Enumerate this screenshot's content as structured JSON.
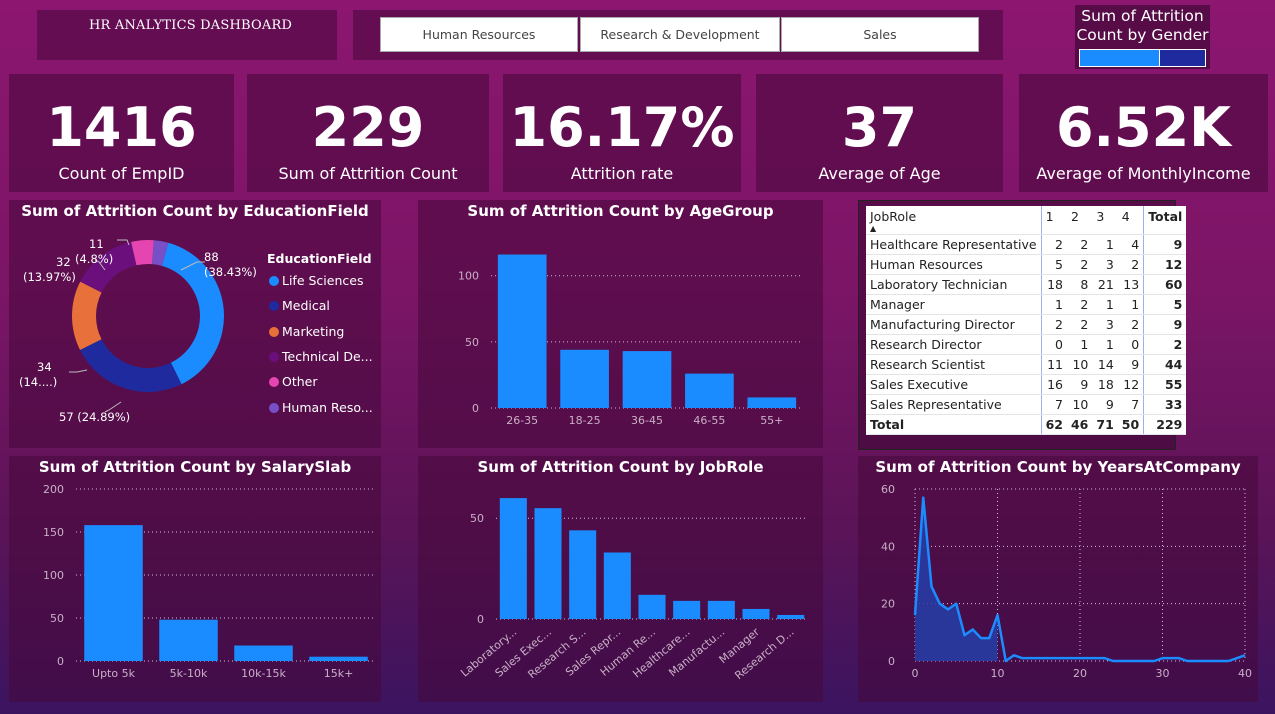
{
  "header": {
    "title": "HR ANALYTICS DASHBOARD"
  },
  "slicer": {
    "departments": [
      "Human Resources",
      "Research & Development",
      "Sales"
    ]
  },
  "gender_card": {
    "title": "Sum of Attrition Count by Gender",
    "colors": [
      "#1b8cff",
      "#1f2a9e"
    ],
    "female_share": 0.63
  },
  "kpis": [
    {
      "value": "1416",
      "label": "Count of EmpID"
    },
    {
      "value": "229",
      "label": "Sum of Attrition Count"
    },
    {
      "value": "16.17%",
      "label": "Attrition rate"
    },
    {
      "value": "37",
      "label": "Average of Age"
    },
    {
      "value": "6.52K",
      "label": "Average of MonthlyIncome"
    }
  ],
  "education": {
    "title": "Sum of Attrition Count by EducationField",
    "legend_title": "EducationField",
    "legend": [
      "Life Sciences",
      "Medical",
      "Marketing",
      "Technical De...",
      "Other",
      "Human Reso..."
    ],
    "labels": {
      "life_sciences": [
        "88",
        "(38.43%)"
      ],
      "medical": [
        "57 (24.89%)"
      ],
      "marketing": [
        "34",
        "(14....)"
      ],
      "technical": [
        "32",
        "(13.97%)"
      ],
      "other": [
        "11",
        "(4.8%)"
      ]
    }
  },
  "age": {
    "title": "Sum of Attrition Count by AgeGroup"
  },
  "salary": {
    "title": "Sum of Attrition Count by SalarySlab"
  },
  "jobrole": {
    "title": "Sum of Attrition Count by JobRole"
  },
  "years": {
    "title": "Sum of Attrition Count by YearsAtCompany"
  },
  "table": {
    "headers": [
      "JobRole",
      "1",
      "2",
      "3",
      "4",
      "Total"
    ],
    "rows": [
      [
        "Healthcare Representative",
        "2",
        "2",
        "1",
        "4",
        "9"
      ],
      [
        "Human Resources",
        "5",
        "2",
        "3",
        "2",
        "12"
      ],
      [
        "Laboratory Technician",
        "18",
        "8",
        "21",
        "13",
        "60"
      ],
      [
        "Manager",
        "1",
        "2",
        "1",
        "1",
        "5"
      ],
      [
        "Manufacturing Director",
        "2",
        "2",
        "3",
        "2",
        "9"
      ],
      [
        "Research Director",
        "0",
        "1",
        "1",
        "0",
        "2"
      ],
      [
        "Research Scientist",
        "11",
        "10",
        "14",
        "9",
        "44"
      ],
      [
        "Sales Executive",
        "16",
        "9",
        "18",
        "12",
        "55"
      ],
      [
        "Sales Representative",
        "7",
        "10",
        "9",
        "7",
        "33"
      ],
      [
        "Total",
        "62",
        "46",
        "71",
        "50",
        "229"
      ]
    ]
  },
  "chart_data": [
    {
      "type": "pie",
      "title": "Sum of Attrition Count by EducationField",
      "categories": [
        "Life Sciences",
        "Medical",
        "Marketing",
        "Technical Degree",
        "Other",
        "Human Resources"
      ],
      "values": [
        88,
        57,
        34,
        32,
        11,
        7
      ],
      "colors": [
        "#1b8cff",
        "#1f2a9e",
        "#e8703a",
        "#6a0f7c",
        "#e445b0",
        "#7750c8"
      ],
      "legend": "right"
    },
    {
      "type": "bar",
      "title": "Sum of Attrition Count by AgeGroup",
      "categories": [
        "26-35",
        "18-25",
        "36-45",
        "46-55",
        "55+"
      ],
      "values": [
        116,
        44,
        43,
        26,
        8
      ],
      "ylim": [
        0,
        130
      ],
      "yticks": [
        0,
        50,
        100
      ],
      "grid": true
    },
    {
      "type": "bar",
      "title": "Sum of Attrition Count by SalarySlab",
      "categories": [
        "Upto 5k",
        "5k-10k",
        "10k-15k",
        "15k+"
      ],
      "values": [
        158,
        48,
        18,
        5
      ],
      "ylim": [
        0,
        200
      ],
      "yticks": [
        0,
        50,
        100,
        150,
        200
      ],
      "grid": true
    },
    {
      "type": "bar",
      "title": "Sum of Attrition Count by JobRole",
      "categories": [
        "Laboratory...",
        "Sales Exec...",
        "Research S...",
        "Sales Repr...",
        "Human Re...",
        "Healthcare...",
        "Manufactu...",
        "Manager",
        "Research D..."
      ],
      "values": [
        60,
        55,
        44,
        33,
        12,
        9,
        9,
        5,
        2
      ],
      "ylim": [
        0,
        66
      ],
      "yticks": [
        0,
        50
      ],
      "grid": true
    },
    {
      "type": "area",
      "title": "Sum of Attrition Count by YearsAtCompany",
      "x": [
        0,
        1,
        2,
        3,
        4,
        5,
        6,
        7,
        8,
        9,
        10,
        11,
        12,
        13,
        14,
        15,
        16,
        17,
        18,
        19,
        20,
        21,
        22,
        23,
        24,
        25,
        26,
        27,
        28,
        29,
        30,
        31,
        32,
        33,
        34,
        35,
        36,
        37,
        38,
        39,
        40
      ],
      "y": [
        16,
        57,
        26,
        20,
        18,
        20,
        9,
        11,
        8,
        8,
        16,
        0,
        2,
        1,
        1,
        1,
        1,
        1,
        1,
        1,
        1,
        1,
        1,
        1,
        0,
        0,
        0,
        0,
        0,
        0,
        1,
        1,
        1,
        0,
        0,
        0,
        0,
        0,
        0,
        1,
        2
      ],
      "xlim": [
        0,
        40
      ],
      "ylim": [
        0,
        60
      ],
      "xticks": [
        0,
        10,
        20,
        30,
        40
      ],
      "yticks": [
        0,
        20,
        40,
        60
      ],
      "grid": true
    }
  ]
}
